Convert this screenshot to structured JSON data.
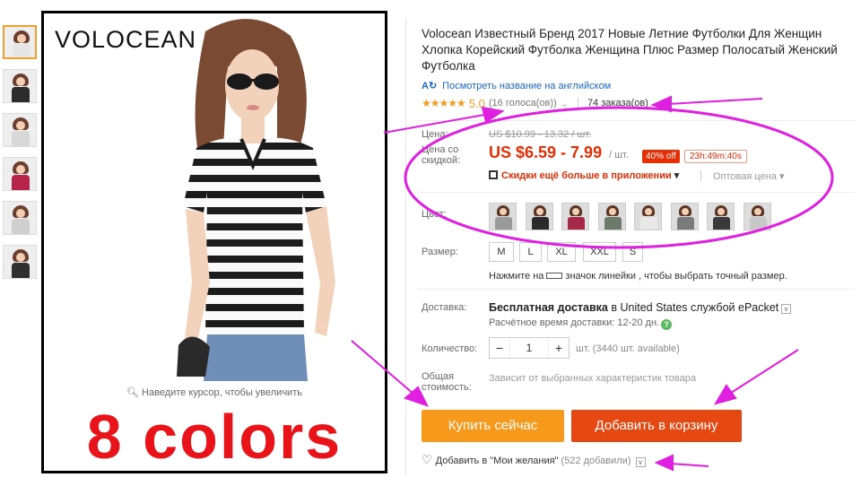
{
  "gallery": {
    "brand": "VOLOCEAN",
    "zoom_hint": "Наведите курсор, чтобы увеличить",
    "promo_text": "8 colors",
    "thumbs": [
      "#e6e6e6",
      "#2c2c2c",
      "#d8d8d8",
      "#b8244a",
      "#cfcfcf",
      "#303030"
    ]
  },
  "product": {
    "title": "Volocean Известный Бренд 2017 Новые Летние Футболки Для Женщин Хлопка Корейский Футболка Женщина Плюс Размер Полосатый Женский Футболка",
    "translate_link": "Посмотреть название на английском",
    "rating_score": "5.0",
    "rating_votes": "(16 голоса(ов))",
    "orders": "74 заказа(ов)"
  },
  "price": {
    "label": "Цена:",
    "old": "US $10.99 - 13.32 / шт.",
    "discount_label": "Цена со скидкой:",
    "current": "US $6.59 - 7.99",
    "unit": "/ шт.",
    "off": "40% off",
    "timer": "23h:49m:40s",
    "app_discount": "Скидки ещё больше в приложении",
    "wholesale": "Оптовая цена"
  },
  "options": {
    "color_label": "Цвет:",
    "colors": [
      "#9a9a9a",
      "#2a2a2a",
      "#a52a4a",
      "#6b7a6a",
      "#e8e8e8",
      "#7a7a7a",
      "#3a3a3a",
      "#c8c8c8"
    ],
    "size_label": "Размер:",
    "sizes": [
      "M",
      "L",
      "XL",
      "XXL",
      "S"
    ],
    "size_note_pre": "Нажмите на",
    "size_note_post": "значок линейки , чтобы выбрать точный размер."
  },
  "shipping": {
    "label": "Доставка:",
    "text_1": "Бесплатная доставка",
    "text_2": " в United States службой ",
    "service": "ePacket",
    "estimate": "Расчётное время доставки: 12-20 дн."
  },
  "quantity": {
    "label": "Количество:",
    "value": "1",
    "available": "шт. (3440 шт. available)"
  },
  "total": {
    "label": "Общая стоимость:",
    "note": "Зависит от выбранных характеристик товара"
  },
  "actions": {
    "buy_now": "Купить сейчас",
    "add_to_cart": "Добавить в корзину",
    "wishlist": "Добавить в \"Мои желания\"",
    "wishlist_count": "(522 добавили)"
  },
  "icons": {
    "translate": "ai-translate-icon",
    "help": "help-icon",
    "heart": "heart-icon",
    "ruler": "ruler-icon",
    "qr": "qr-code-icon"
  },
  "colors": {
    "price_red": "#e62e04",
    "buy_orange": "#f79a1c",
    "cart_orange": "#e64811",
    "annotation_magenta": "#e020e0",
    "promo_red": "#e8141a"
  }
}
